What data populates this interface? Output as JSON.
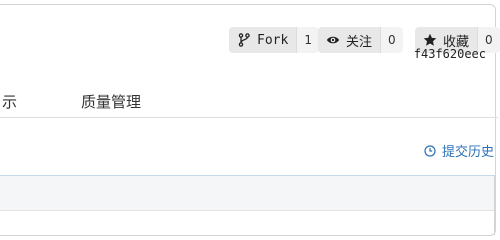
{
  "actions": {
    "fork": {
      "label": "Fork",
      "count": "1",
      "icon": "fork-icon"
    },
    "watch": {
      "label": "关注",
      "count": "0",
      "icon": "eye-icon"
    },
    "star": {
      "label": "收藏",
      "count": "0",
      "icon": "star-icon"
    }
  },
  "tabs": [
    {
      "label": "示"
    },
    {
      "label": "质量管理"
    }
  ],
  "history": {
    "label": "提交历史",
    "icon": "history-clock-icon"
  },
  "commit": {
    "hash": "f43f620eec"
  },
  "colors": {
    "link": "#2b72b8",
    "button_bg": "#e8e8e8",
    "border": "#d4d4d5"
  }
}
